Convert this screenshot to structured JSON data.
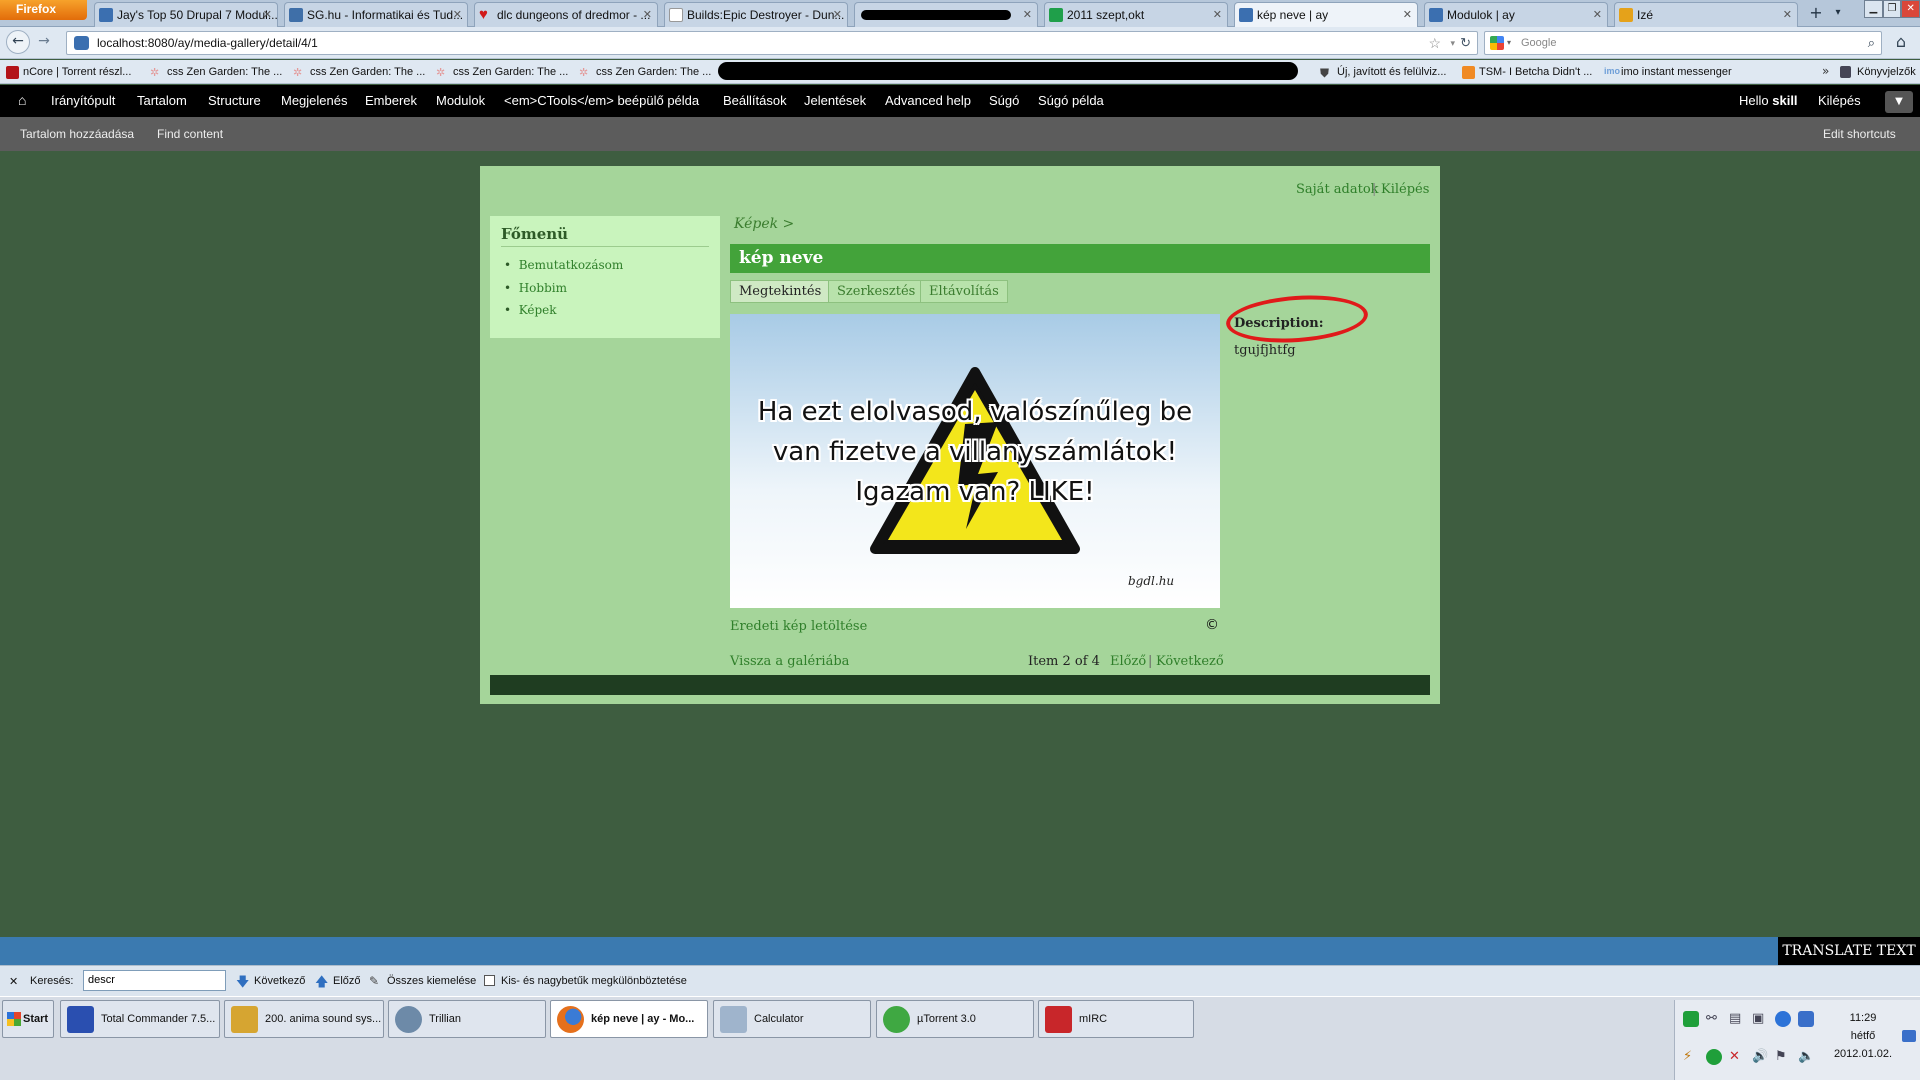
{
  "browser": {
    "app_button": "Firefox",
    "tabs": [
      {
        "label": "Jay's Top 50 Drupal 7 Modul...",
        "icon": "drupal-favicon",
        "color": "#3b6fb0"
      },
      {
        "label": "SG.hu - Informatikai és Tud...",
        "icon": "sg-favicon",
        "color": "#3f6fa8"
      },
      {
        "label": "dlc dungeons of dredmor - ...",
        "icon": "heart-favicon",
        "color": "#d11a1a"
      },
      {
        "label": "Builds:Epic Destroyer - Dun...",
        "icon": "page-favicon",
        "color": "#bbbbbb"
      },
      {
        "label": "",
        "icon": "redacted-tab",
        "color": "#d11a1a"
      },
      {
        "label": "2011 szept,okt",
        "icon": "sheet-favicon",
        "color": "#1f9f4a"
      },
      {
        "label": "kép neve | ay",
        "icon": "drupal-favicon",
        "color": "#3b6fb0"
      },
      {
        "label": "Modulok | ay",
        "icon": "drupal-favicon",
        "color": "#3b6fb0"
      },
      {
        "label": "Izé",
        "icon": "ize-favicon",
        "color": "#e5a21a"
      }
    ],
    "new_tab": "+",
    "url": "localhost:8080/ay/media-gallery/detail/4/1",
    "search_placeholder": "Google",
    "bookmarks": [
      {
        "label": "nCore | Torrent részl...",
        "color": "#b3141a"
      },
      {
        "label": "css Zen Garden: The ...",
        "color": "#f0b9b9"
      },
      {
        "label": "css Zen Garden: The ...",
        "color": "#f0b9b9"
      },
      {
        "label": "css Zen Garden: The ...",
        "color": "#f0b9b9"
      },
      {
        "label": "css Zen Garden: The ...",
        "color": "#f0b9b9"
      },
      {
        "label": "Új, javított és felülviz...",
        "color": "#444444"
      },
      {
        "label": "TSM- I Betcha Didn't ...",
        "color": "#f08a24"
      },
      {
        "label": "imo instant messenger",
        "color": "#6f9fd8"
      }
    ],
    "bookmarks_menu": "Könyvjelzők"
  },
  "toolbar": {
    "items": [
      "Irányítópult",
      "Tartalom",
      "Structure",
      "Megjelenés",
      "Emberek",
      "Modulok",
      "<em>CTools</em> beépülő példa",
      "Beállítások",
      "Jelentések",
      "Advanced help",
      "Súgó",
      "Súgó példa"
    ],
    "hello": "Hello",
    "user": "skill",
    "logout": "Kilépés"
  },
  "shortcuts": {
    "add_content": "Tartalom hozzáadása",
    "find_content": "Find content",
    "edit_shortcuts": "Edit shortcuts"
  },
  "site": {
    "user_links": [
      "Saját adatok",
      "Kilépés"
    ],
    "sidebar_title": "Főmenü",
    "menu": [
      "Bemutatkozásom",
      "Hobbim",
      "Képek"
    ],
    "breadcrumb": "Képek >",
    "page_title": "kép neve",
    "tabs": [
      "Megtekintés",
      "Szerkesztés",
      "Eltávolítás"
    ],
    "image_text": [
      "Ha ezt elolvasod, valószínűleg be",
      "van fizetve a villanyszámlátok!",
      "Igazam van? LIKE!"
    ],
    "watermark": "bgdl.hu",
    "description_label": "Description:",
    "description_value": "tgujfjhtfg",
    "download_link": "Eredeti kép letöltése",
    "copyright": "©",
    "back_link": "Vissza a galériába",
    "item_counter": "Item 2 of 4",
    "prev": "Előző",
    "pipe": "|",
    "next": "Következő"
  },
  "translate_button": "TRANSLATE TEXT",
  "findbar": {
    "label": "Keresés:",
    "value": "descr",
    "next": "Következő",
    "prev": "Előző",
    "highlight_all": "Összes kiemelése",
    "match_case": "Kis- és nagybetűk megkülönböztetése"
  },
  "taskbar": {
    "start": "Start",
    "tasks": [
      {
        "label": "Total Commander 7.5...",
        "color": "#2a4fb0"
      },
      {
        "label": "200. anima sound sys...",
        "color": "#d6a531"
      },
      {
        "label": "Trillian",
        "color": "#6d8aa8"
      },
      {
        "label": "kép neve | ay - Mo...",
        "color": "#e5701c"
      },
      {
        "label": "Calculator",
        "color": "#9fb4cc"
      },
      {
        "label": "µTorrent 3.0",
        "color": "#3fa842"
      },
      {
        "label": "mIRC",
        "color": "#c8262a"
      }
    ],
    "clock_time": "11:29",
    "clock_day": "hétfő",
    "clock_date": "2012.01.02."
  }
}
